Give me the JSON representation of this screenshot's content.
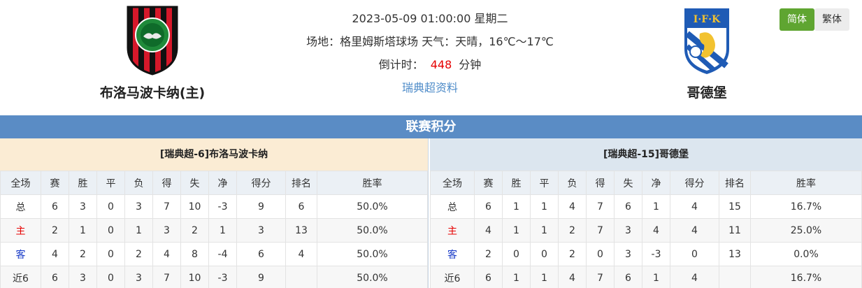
{
  "match": {
    "datetime": "2023-05-09 01:00:00 星期二",
    "venue_weather": "场地：格里姆斯塔球场 天气：天晴，16℃～17℃",
    "countdown_label": "倒计时：",
    "countdown_value": "448",
    "countdown_unit": "分钟",
    "league_link": "瑞典超资料"
  },
  "home_team": {
    "name": "布洛马波卡纳(主)"
  },
  "away_team": {
    "name": "哥德堡"
  },
  "lang": {
    "simplified": "简体",
    "traditional": "繁体"
  },
  "standings": {
    "title": "联赛积分",
    "columns": [
      "全场",
      "赛",
      "胜",
      "平",
      "负",
      "得",
      "失",
      "净",
      "得分",
      "排名",
      "胜率"
    ],
    "home": {
      "title": "[瑞典超-6]布洛马波卡纳",
      "rows": [
        [
          "总",
          "6",
          "3",
          "0",
          "3",
          "7",
          "10",
          "-3",
          "9",
          "6",
          "50.0%"
        ],
        [
          "主",
          "2",
          "1",
          "0",
          "1",
          "3",
          "2",
          "1",
          "3",
          "13",
          "50.0%"
        ],
        [
          "客",
          "4",
          "2",
          "0",
          "2",
          "4",
          "8",
          "-4",
          "6",
          "4",
          "50.0%"
        ],
        [
          "近6",
          "6",
          "3",
          "0",
          "3",
          "7",
          "10",
          "-3",
          "9",
          "",
          "50.0%"
        ]
      ]
    },
    "away": {
      "title": "[瑞典超-15]哥德堡",
      "rows": [
        [
          "总",
          "6",
          "1",
          "1",
          "4",
          "7",
          "6",
          "1",
          "4",
          "15",
          "16.7%"
        ],
        [
          "主",
          "4",
          "1",
          "1",
          "2",
          "7",
          "3",
          "4",
          "4",
          "11",
          "25.0%"
        ],
        [
          "客",
          "2",
          "0",
          "0",
          "2",
          "0",
          "3",
          "-3",
          "0",
          "13",
          "0.0%"
        ],
        [
          "近6",
          "6",
          "1",
          "1",
          "4",
          "7",
          "6",
          "1",
          "4",
          "",
          "16.7%"
        ]
      ]
    }
  }
}
